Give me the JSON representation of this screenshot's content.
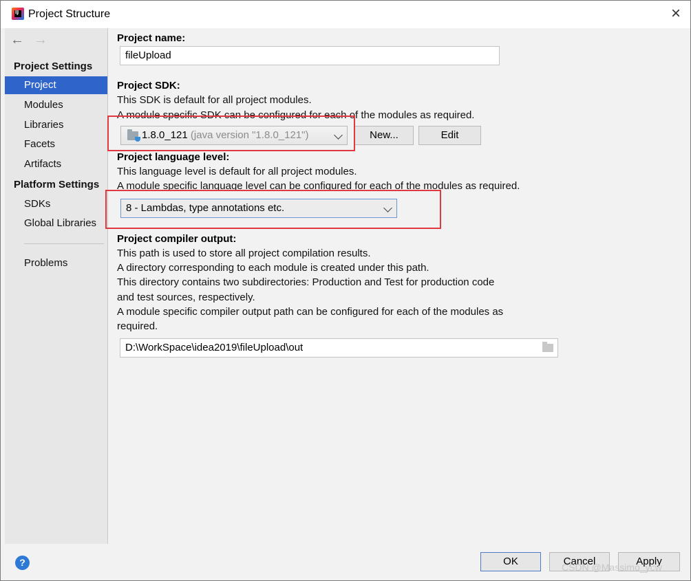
{
  "window": {
    "title": "Project Structure",
    "close_glyph": "×"
  },
  "sidebar": {
    "back_glyph": "←",
    "forward_glyph": "→",
    "project_settings_header": "Project Settings",
    "project_items": [
      "Project",
      "Modules",
      "Libraries",
      "Facets",
      "Artifacts"
    ],
    "selected": "Project",
    "platform_settings_header": "Platform Settings",
    "platform_items": [
      "SDKs",
      "Global Libraries"
    ],
    "problems": "Problems"
  },
  "project_name": {
    "label": "Project name:",
    "value": "fileUpload"
  },
  "project_sdk": {
    "label": "Project SDK:",
    "desc1": "This SDK is default for all project modules.",
    "desc2": "A module specific SDK can be configured for each of the modules as required.",
    "selected_name": "1.8.0_121",
    "selected_detail": "(java version \"1.8.0_121\")",
    "new_button": "New...",
    "edit_button": "Edit"
  },
  "language_level": {
    "label": "Project language level:",
    "desc1": "This language level is default for all project modules.",
    "desc2": "A module specific language level can be configured for each of the modules as required.",
    "selected": "8 - Lambdas, type annotations etc."
  },
  "compiler_output": {
    "label": "Project compiler output:",
    "lines": [
      "This path is used to store all project compilation results.",
      "A directory corresponding to each module is created under this path.",
      "This directory contains two subdirectories: Production and Test for production code",
      "and test sources, respectively.",
      "A module specific compiler output path can be configured for each of the modules as",
      "required."
    ],
    "path": "D:\\WorkSpace\\idea2019\\fileUpload\\out"
  },
  "footer": {
    "help": "?",
    "ok": "OK",
    "cancel": "Cancel",
    "apply": "Apply"
  },
  "watermark": "CSDN @Massimo_ycw",
  "colors": {
    "selection": "#2f65ca",
    "highlight_box": "#e0383e",
    "help": "#2c79d6"
  }
}
